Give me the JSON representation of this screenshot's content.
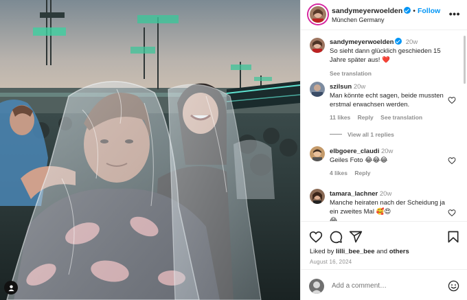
{
  "post": {
    "photo_alt": "Concert crowd photo",
    "author": "sandymeyerwoelden",
    "follow_label": "Follow",
    "location": "München Germany"
  },
  "caption": {
    "username": "sandymeyerwoelden",
    "time": "20w",
    "text": "So sieht dann glücklich geschieden 15 Jahre später aus! ❤️",
    "see_translation": "See translation"
  },
  "comments": [
    {
      "username": "szilsun",
      "time": "20w",
      "text": "Man könnte echt sagen, beide mussten erstmal erwachsen werden.",
      "likes": "11 likes",
      "reply": "Reply",
      "see_translation": "See translation",
      "view_replies": "View all 1 replies"
    },
    {
      "username": "elbgoere_claudi",
      "time": "20w",
      "text": "Geiles Foto 😂😂😂",
      "likes": "4 likes",
      "reply": "Reply"
    },
    {
      "username": "tamara_lachner",
      "time": "20w",
      "text": "Manche heiraten nach der Scheidung ja ein zweites Mal 🥰😍",
      "tail": "😂"
    }
  ],
  "footer": {
    "liked_by_prefix": "Liked by",
    "liked_by_user": "lilli_bee_bee",
    "liked_by_and": "and",
    "liked_by_others": "others",
    "date": "August 16, 2024",
    "comment_placeholder": "Add a comment…"
  },
  "icons": {
    "verified": "verified-badge-icon",
    "more": "more-options-icon",
    "like": "heart-icon",
    "comment": "comment-icon",
    "share": "share-icon",
    "save": "bookmark-icon",
    "emoji": "emoji-icon",
    "tags": "user-tag-icon"
  },
  "colors": {
    "accent": "#0095f6",
    "heart": "#ed4956",
    "muted": "#8e8e8e",
    "text": "#262626"
  }
}
